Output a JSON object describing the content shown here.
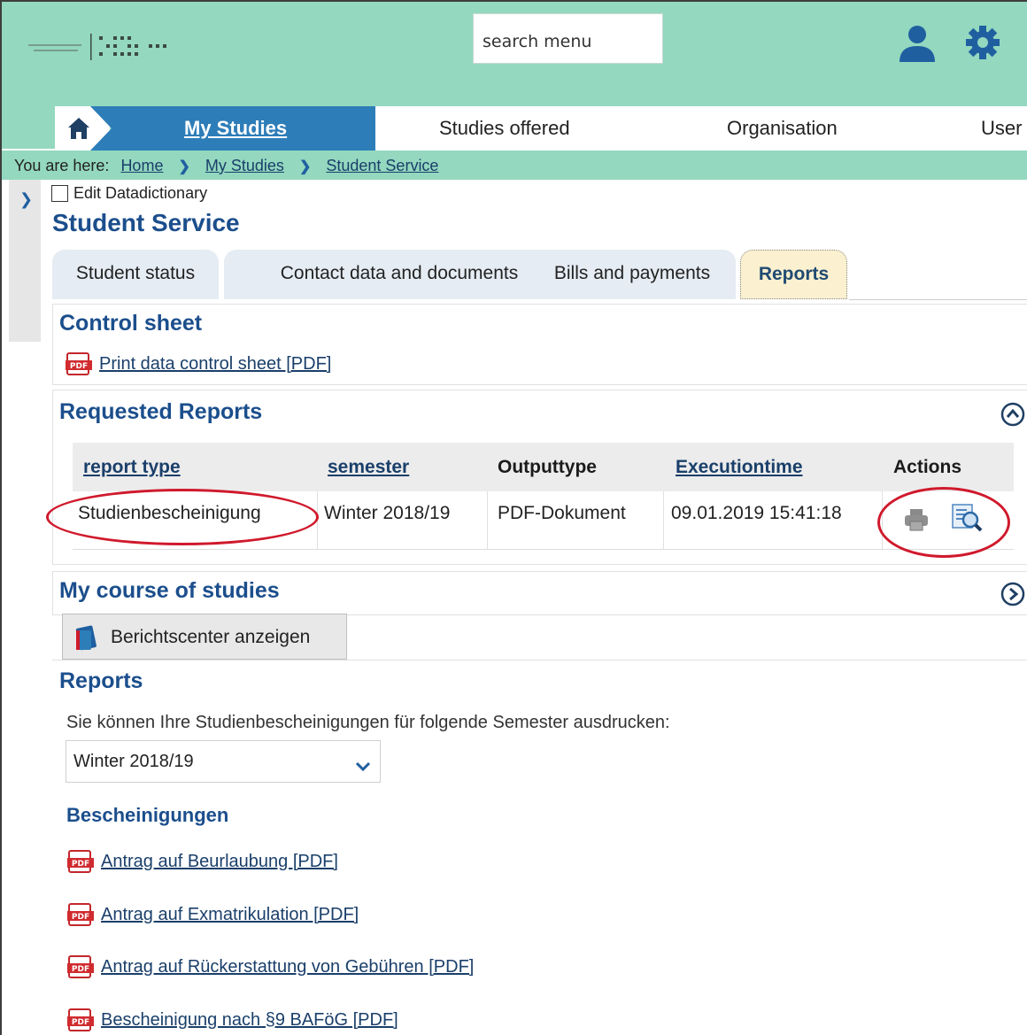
{
  "header": {
    "logo_text": "HOCHSCHULE TRIER",
    "search_label": "search menu"
  },
  "nav": {
    "active": "My Studies",
    "items": [
      "Studies offered",
      "Organisation",
      "User"
    ]
  },
  "breadcrumb": {
    "prefix": "You are here:",
    "items": [
      "Home",
      "My Studies",
      "Student Service"
    ]
  },
  "edit_datadictionary": "Edit Datadictionary",
  "page_title": "Student Service",
  "tabs": [
    "Student status",
    "Contact data and documents",
    "Bills and payments",
    "Reports"
  ],
  "control_sheet": {
    "title": "Control sheet",
    "link": "Print data control sheet [PDF]"
  },
  "requested_reports": {
    "title": "Requested Reports",
    "columns": [
      "report type",
      "semester",
      "Outputtype",
      "Executiontime",
      "Actions"
    ],
    "row": {
      "report_type": "Studienbescheinigung",
      "semester": "Winter 2018/19",
      "outputtype": "PDF-Dokument",
      "executiontime": "09.01.2019 15:41:18"
    }
  },
  "course_of_studies": {
    "title": "My course of studies",
    "button": "Berichtscenter anzeigen"
  },
  "reports": {
    "title": "Reports",
    "description": "Sie können Ihre Studienbescheinigungen für folgende Semester ausdrucken:",
    "semester_selected": "Winter 2018/19",
    "certificates_title": "Bescheinigungen",
    "links": [
      "Antrag auf Beurlaubung [PDF]",
      "Antrag auf Exmatrikulation [PDF]",
      "Antrag auf Rückerstattung von Gebühren [PDF]",
      "Bescheinigung nach §9 BAFöG [PDF]"
    ]
  },
  "colors": {
    "header_bg": "#93d8bf",
    "nav_active": "#2d7db8",
    "title_blue": "#1b4e8c",
    "highlight_red": "#d0192c"
  },
  "icons": [
    "home-icon",
    "user-icon",
    "gear-icon",
    "pdf-icon",
    "printer-icon",
    "preview-icon",
    "collapse-icon",
    "expand-icon",
    "book-icon",
    "chevron-down-icon"
  ]
}
